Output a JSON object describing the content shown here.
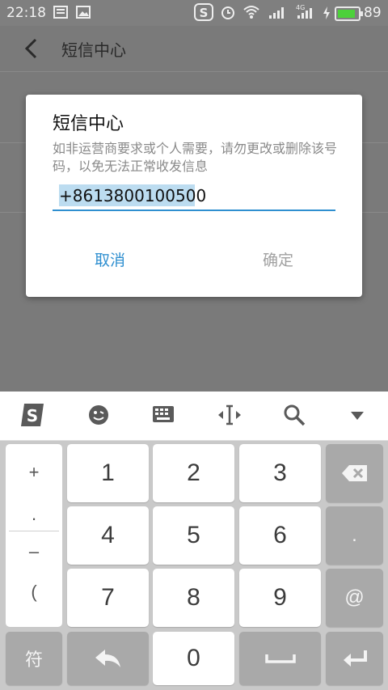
{
  "status_bar": {
    "time": "22:18",
    "battery_level": "89",
    "battery_fraction": 0.89,
    "icons": [
      "news-icon",
      "picture-icon",
      "sogou-icon",
      "alarm-icon",
      "wifi-icon",
      "signal-icon",
      "signal-4g-icon",
      "charging-icon",
      "battery-icon"
    ]
  },
  "app_bar": {
    "title": "短信中心",
    "back_icon": "back-arrow-icon"
  },
  "dialog": {
    "title": "短信中心",
    "message": "如非运营商要求或个人需要，请勿更改或删除该号码，以免无法正常收发信息",
    "input_value": "+8613800100500",
    "cancel_label": "取消",
    "confirm_label": "确定",
    "accent": "#2f8fd0"
  },
  "keyboard_toolbar": {
    "icons": [
      "sogou-logo-icon",
      "emoji-icon",
      "keyboard-icon",
      "cursor-icon",
      "search-icon",
      "collapse-icon"
    ]
  },
  "keyboard": {
    "symbols": [
      "+",
      ".",
      "–",
      "("
    ],
    "digits": [
      "1",
      "2",
      "3",
      "4",
      "5",
      "6",
      "7",
      "8",
      "9",
      "0"
    ],
    "right_keys": [
      ".",
      "@"
    ],
    "symbol_key": "符"
  }
}
